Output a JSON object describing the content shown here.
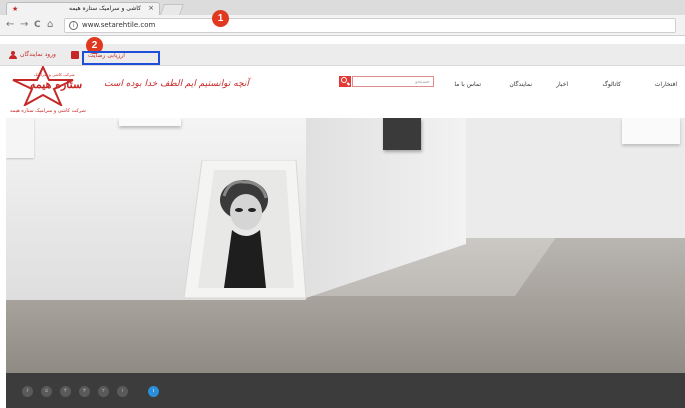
{
  "browser": {
    "tab_title": "کاشی و سرامیک ستاره هیمه",
    "tab_close": "×",
    "url": "www.setarehtile.com",
    "back": "←",
    "forward": "→",
    "reload": "C",
    "home": "⌂",
    "info": "i"
  },
  "annotations": {
    "first": "1",
    "second": "2"
  },
  "topbar": {
    "reseller_login": "ورود نمایندگان",
    "track_order": "ارزیابی رضایت"
  },
  "header": {
    "logo_small": "شرکت کاشی و سرامیک",
    "logo_name": "ستاره هیمه",
    "logo_sub": "شرکت کاشی و سرامیک ستاره هیمه",
    "slogan": "آنچه توانستیم ایم الطف خدا بوده است",
    "search_placeholder": "جستجو",
    "nav": [
      "افتخارات",
      "کاتالوگ",
      "اخبار",
      "نمایندگان",
      "تماس با ما"
    ]
  },
  "slider": {
    "dots": [
      "۶",
      "۵",
      "۴",
      "۳",
      "۲",
      "۱",
      "۱"
    ],
    "active_index": 6
  },
  "colors": {
    "brand_red": "#c62828",
    "annotation_red": "#e0391f",
    "annotation_blue": "#1f4fd6",
    "active_dot": "#2b8ed8"
  }
}
